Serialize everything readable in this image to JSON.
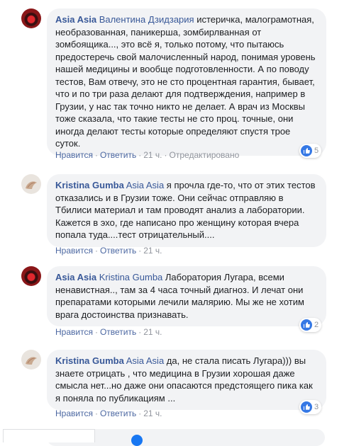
{
  "comments": [
    {
      "author": "Asia Asia",
      "mention": "Валентина Дзидзария",
      "text": " истеричка, малограмотная, необразованная, паникерша, зомбирлванная от зомбоящика..., это всё я, только потому, что пытаюсь предостеречь свой малочисленный народ, понимая уровень нашей медицины и вообще подготовленности. А по поводу тестов, Вам отвечу, это не сто процентная гарантия, бывает, что и по три раза делают для подтверждения, например в Грузии, у нас так точно никто не делает. А врач из Москвы тоже сказала, что такие тесты не сто проц. точные, они иногда делают тесты которые определяют спустя трое суток.",
      "like": "Нравится",
      "reply": "Ответить",
      "time": "21 ч.",
      "edited": "Отредактировано",
      "reactions": "5"
    },
    {
      "author": "Kristina Gumba",
      "mention": "Asia Asia",
      "text": " я прочла где-то, что от этих тестов отказались и в Грузии тоже. Они сейчас отправляю в Тбилиси материал и там проводят анализ а лаборатории. Кажется в эхо, где написано про женщину которая вчера попала туда....тест отрицательный....",
      "like": "Нравится",
      "reply": "Ответить",
      "time": "21 ч."
    },
    {
      "author": "Asia Asia",
      "mention": "Kristina Gumba",
      "text": " Лаборатория Лугара, всеми ненавистная.., там за 4 часа точный диагноз. И лечат они препаратами которыми лечили малярию. Мы же не хотим врага достоинства признавать.",
      "like": "Нравится",
      "reply": "Ответить",
      "time": "21 ч.",
      "reactions": "2"
    },
    {
      "author": "Kristina Gumba",
      "mention": "Asia Asia",
      "text": " да, не стала писать Лугара))) вы знаете отрицать , что медицина в Грузии хорошая даже смысла нет...но даже они опасаются предстоящего пика как я поняла по публикациям ...",
      "like": "Нравится",
      "reply": "Ответить",
      "time": "21 ч.",
      "reactions": "3"
    }
  ],
  "colors": {
    "author": "#385898",
    "bubble": "#f2f3f5",
    "like_badge": "#3578e5",
    "meta": "#90949c"
  },
  "icons": {
    "like": "thumbs-up-icon"
  }
}
